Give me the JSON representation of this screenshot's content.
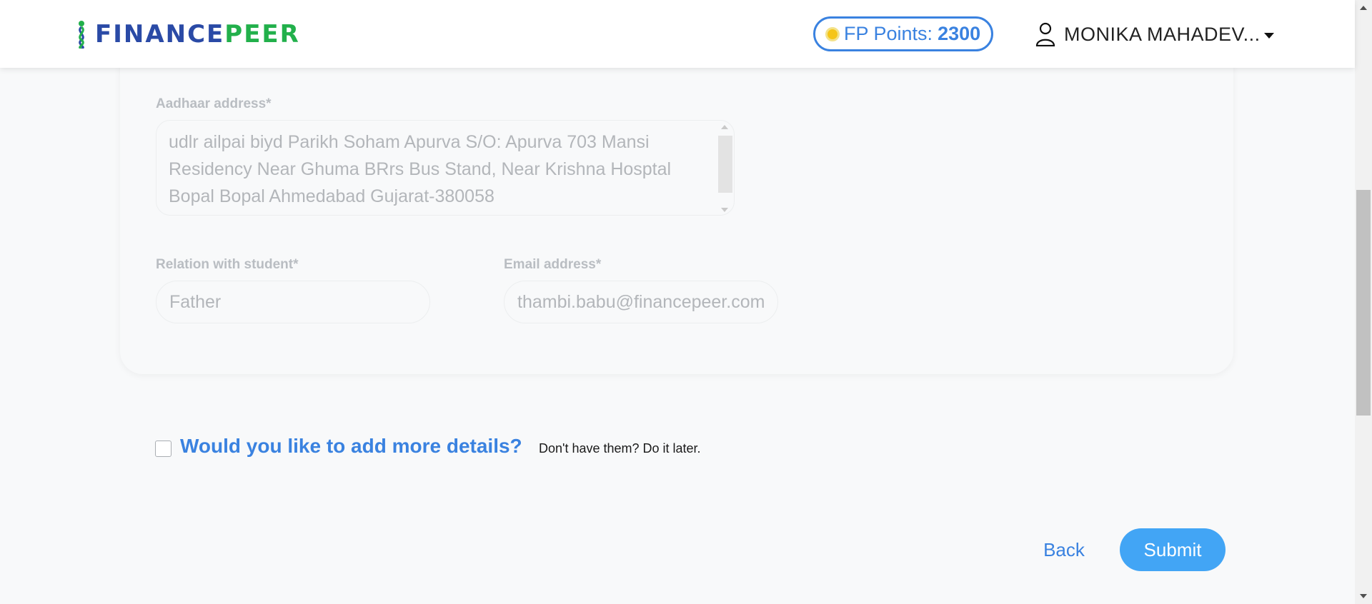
{
  "header": {
    "logo": {
      "part1": "FINANCE",
      "part2": "PEER"
    },
    "points": {
      "label": "FP Points:",
      "value": "2300"
    },
    "user": {
      "name": "MONIKA MAHADEV..."
    }
  },
  "form": {
    "aadhaar_address": {
      "label": "Aadhaar address*",
      "value": "udlr ailpai biyd Parikh Soham Apurva S/O: Apurva 703 Mansi Residency Near Ghuma BRrs Bus Stand, Near Krishna Hosptal Bopal Bopal Ahmedabad Gujarat-380058"
    },
    "relation": {
      "label": "Relation with student*",
      "value": "Father"
    },
    "email": {
      "label": "Email address*",
      "value": "thambi.babu@financepeer.com"
    }
  },
  "more_details": {
    "title": "Would you like to add more details?",
    "subtitle": "Don't have them? Do it later."
  },
  "actions": {
    "back": "Back",
    "submit": "Submit"
  },
  "colors": {
    "accent": "#3a82e0",
    "brand_blue": "#2a4aa6",
    "brand_green": "#22b04b",
    "submit_bg": "#42a5f5"
  }
}
